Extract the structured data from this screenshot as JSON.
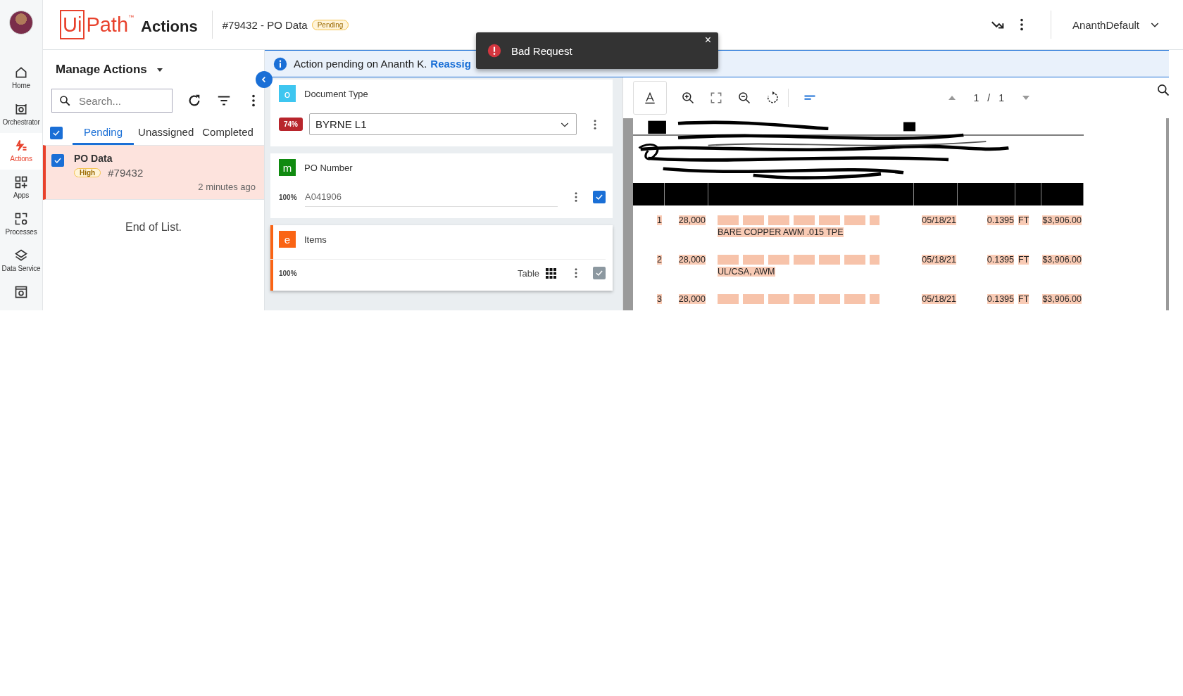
{
  "header": {
    "logo_boxed": "Ui",
    "logo_rest": "Path",
    "logo_tm": "™",
    "product": "Actions",
    "task_title": "#79432 - PO Data",
    "status": "Pending",
    "user": "AnanthDefault"
  },
  "nav": [
    {
      "kind": "home",
      "label": "Home",
      "selected": false
    },
    {
      "kind": "robot",
      "label": "Orchestrator",
      "selected": false
    },
    {
      "kind": "actions",
      "label": "Actions",
      "selected": true
    },
    {
      "kind": "apps",
      "label": "Apps",
      "selected": false
    },
    {
      "kind": "processes",
      "label": "Processes",
      "selected": false
    },
    {
      "kind": "data",
      "label": "Data Service",
      "selected": false
    },
    {
      "kind": "admin"
    }
  ],
  "list": {
    "title": "Manage Actions",
    "search": {
      "placeholder": "Search..."
    },
    "select_all_checked": true,
    "tabs": [
      {
        "label": "Pending",
        "selected": true
      },
      {
        "label": "Unassigned",
        "selected": false
      },
      {
        "label": "Completed",
        "selected": false
      }
    ],
    "items": [
      {
        "title": "PO Data",
        "priority": "High",
        "id": "#79432",
        "time": "2 minutes ago",
        "checked": true,
        "selected": true
      }
    ],
    "end_text": "End of List."
  },
  "banner": {
    "text": "Action pending on Ananth K.",
    "link": "Reassig"
  },
  "toast": {
    "message": "Bad Request",
    "close": "×"
  },
  "fields": [
    {
      "kind": "dropdown",
      "letter": "o",
      "color": "#3ec6f0",
      "label": "Document Type",
      "confidence": "74%",
      "low_confidence": true,
      "value": "BYRNE L1",
      "selected": false
    },
    {
      "kind": "text",
      "letter": "m",
      "color": "#108a10",
      "label": "PO Number",
      "confidence": "100%",
      "low_confidence": false,
      "value": "A041906",
      "checked": true,
      "disabled": false,
      "selected": false
    },
    {
      "kind": "table",
      "letter": "e",
      "color": "#fa6414",
      "label": "Items",
      "confidence": "100%",
      "low_confidence": false,
      "value": "Table",
      "checked": true,
      "disabled": true,
      "selected": true
    }
  ],
  "viewer": {
    "page": "1",
    "separator": "/",
    "total": "1",
    "document": {
      "rows": [
        {
          "line": "1",
          "qty": "28,000",
          "desc": [
            "BARE COPPER AWM .015 TPE"
          ],
          "date": "05/18/21",
          "price": "0.1395",
          "uom": "FT",
          "total": "$3,906.00"
        },
        {
          "line": "2",
          "qty": "28,000",
          "desc": [
            "UL/CSA, AWM"
          ],
          "date": "05/18/21",
          "price": "0.1395",
          "uom": "FT",
          "total": "$3,906.00"
        },
        {
          "line": "3",
          "qty": "28,000",
          "desc": [],
          "date": "05/18/21",
          "price": "0.1395",
          "uom": "FT",
          "total": "$3,906.00"
        }
      ]
    }
  }
}
